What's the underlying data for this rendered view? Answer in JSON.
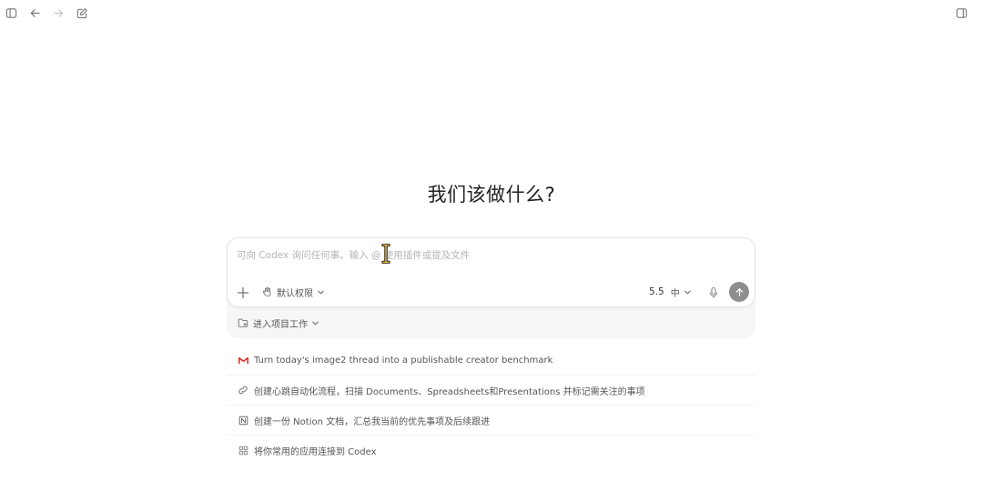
{
  "topbar": {
    "icons": [
      "sidebar-toggle-icon",
      "back-arrow-icon",
      "forward-arrow-icon",
      "new-chat-icon"
    ],
    "right_icon": "panel-icon"
  },
  "headline": "我们该做什么?",
  "composer": {
    "placeholder": "可向 Codex 询问任何事。输入 @ 使用插件或提及文件",
    "value": "",
    "permission_label": "默认权限",
    "model_version": "5.5",
    "model_effort": "中",
    "project_label": "进入项目工作"
  },
  "suggestions": [
    {
      "icon": "gmail-icon",
      "label": "Turn today's image2 thread into a publishable creator benchmark"
    },
    {
      "icon": "link-icon",
      "label": "创建心跳自动化流程，扫描 Documents、Spreadsheets和Presentations 并标记需关注的事项"
    },
    {
      "icon": "notion-icon",
      "label": "创建一份 Notion 文档，汇总我当前的优先事项及后续跟进"
    },
    {
      "icon": "apps-grid-icon",
      "label": "将你常用的应用连接到 Codex"
    }
  ],
  "colors": {
    "gmail_red": "#d93025",
    "send_button": "#8e8e8e",
    "cursor_yellow": "#f2c14e"
  }
}
